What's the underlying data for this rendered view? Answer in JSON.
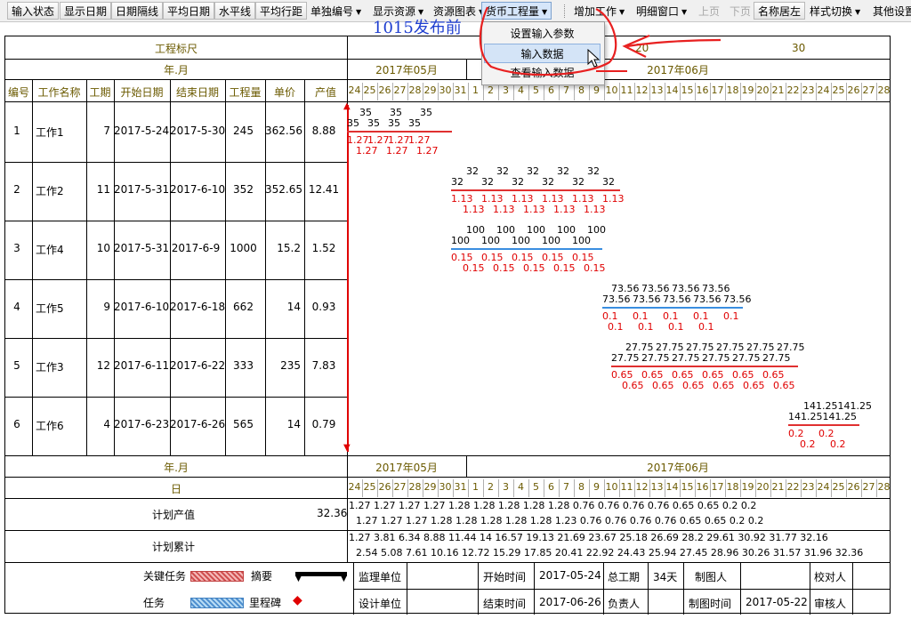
{
  "toolbar": {
    "items": [
      "输入状态",
      "显示日期",
      "日期隔线",
      "平均日期",
      "水平线",
      "平均行距",
      "单独编号",
      "显示资源",
      "资源图表",
      "货币工程量",
      "增加工作",
      "明细窗口",
      "上页",
      "下页",
      "名称居左",
      "样式切换",
      "其他设置"
    ]
  },
  "title": "1015发布前",
  "menu": {
    "items": [
      "设置输入参数",
      "输入数据",
      "查看输入数据"
    ]
  },
  "ruler": {
    "label": "工程标尺",
    "ticks": [
      "20",
      "30"
    ],
    "yearmonth_label": "年.月",
    "day_label": "日",
    "months": [
      "2017年05月",
      "2017年06月"
    ],
    "days": [
      "24",
      "25",
      "26",
      "27",
      "28",
      "29",
      "30",
      "31",
      "1",
      "2",
      "3",
      "4",
      "5",
      "6",
      "7",
      "8",
      "9",
      "10",
      "11",
      "12",
      "13",
      "14",
      "15",
      "16",
      "17",
      "18",
      "19",
      "20",
      "21",
      "22",
      "23",
      "24",
      "25",
      "26",
      "27",
      "28"
    ]
  },
  "table": {
    "headers": [
      "编号",
      "工作名称",
      "工期",
      "开始日期",
      "结束日期",
      "工程量",
      "单价",
      "产值"
    ],
    "rows": [
      [
        "1",
        "工作1",
        "7",
        "2017-5-24",
        "2017-5-30",
        "245",
        "362.56",
        "8.88"
      ],
      [
        "2",
        "工作2",
        "11",
        "2017-5-31",
        "2017-6-10",
        "352",
        "352.65",
        "12.41"
      ],
      [
        "3",
        "工作4",
        "10",
        "2017-5-31",
        "2017-6-9",
        "1000",
        "15.2",
        "1.52"
      ],
      [
        "4",
        "工作5",
        "9",
        "2017-6-10",
        "2017-6-18",
        "662",
        "14",
        "0.93"
      ],
      [
        "5",
        "工作3",
        "12",
        "2017-6-11",
        "2017-6-22",
        "333",
        "235",
        "7.83"
      ],
      [
        "6",
        "工作6",
        "4",
        "2017-6-23",
        "2017-6-26",
        "565",
        "14",
        "0.79"
      ]
    ]
  },
  "bars": [
    {
      "top": [
        "35",
        "35",
        "35"
      ],
      "mid": [
        "35",
        "35",
        "35",
        "35"
      ],
      "r1": [
        "1.27",
        "1.27",
        "1.27",
        "1.27"
      ],
      "r2": [
        "1.27",
        "1.27",
        "1.27"
      ],
      "color": "#e03030"
    },
    {
      "top": [
        "32",
        "32",
        "32",
        "32",
        "32"
      ],
      "mid": [
        "32",
        "32",
        "32",
        "32",
        "32",
        "32"
      ],
      "r1": [
        "1.13",
        "1.13",
        "1.13",
        "1.13",
        "1.13",
        "1.13"
      ],
      "r2": [
        "1.13",
        "1.13",
        "1.13",
        "1.13",
        "1.13"
      ],
      "color": "#e03030"
    },
    {
      "top": [
        "100",
        "100",
        "100",
        "100",
        "100"
      ],
      "mid": [
        "100",
        "100",
        "100",
        "100",
        "100"
      ],
      "r1": [
        "0.15",
        "0.15",
        "0.15",
        "0.15",
        "0.15"
      ],
      "r2": [
        "0.15",
        "0.15",
        "0.15",
        "0.15",
        "0.15"
      ],
      "color": "#3a8ee0"
    },
    {
      "top": [
        "73.56",
        "73.56",
        "73.56",
        "73.56"
      ],
      "mid": [
        "73.56",
        "73.56",
        "73.56",
        "73.56",
        "73.56"
      ],
      "r1": [
        "0.1",
        "0.1",
        "0.1",
        "0.1",
        "0.1"
      ],
      "r2": [
        "0.1",
        "0.1",
        "0.1",
        "0.1"
      ],
      "color": "#3a8ee0"
    },
    {
      "top": [
        "27.75",
        "27.75",
        "27.75",
        "27.75",
        "27.75",
        "27.75"
      ],
      "mid": [
        "27.75",
        "27.75",
        "27.75",
        "27.75",
        "27.75",
        "27.75"
      ],
      "r1": [
        "0.65",
        "0.65",
        "0.65",
        "0.65",
        "0.65",
        "0.65"
      ],
      "r2": [
        "0.65",
        "0.65",
        "0.65",
        "0.65",
        "0.65",
        "0.65"
      ],
      "color": "#e03030"
    },
    {
      "top": [
        "141.25141.25"
      ],
      "mid": [
        "141.25141.25"
      ],
      "r1": [
        "0.2",
        "0.2"
      ],
      "r2": [
        "0.2",
        "0.2"
      ],
      "color": "#e03030"
    }
  ],
  "footer": {
    "plan_value_label": "计划产值",
    "plan_value_total": "32.36",
    "plan_cum_label": "计划累计",
    "plan_value_row1": "1.27 1.27  1.27  1.27  1.28  1.28  1.28  1.28  1.28  0.76  0.76  0.76  0.76  0.65  0.65  0.2   0.2",
    "plan_value_row2": "1.27  1.27  1.27  1.28  1.28  1.28  1.28  1.28  1.23  0.76  0.76  0.76  0.76  0.65  0.65  0.2   0.2",
    "plan_cum_row1": "1.27 3.81  6.34  8.88 11.44  14   16.57 19.13 21.69 23.67 25.18 26.69  28.2  29.61 30.92 31.77 32.16",
    "plan_cum_row2": "2.54  5.08  7.61 10.16 12.72 15.29 17.85 20.41 22.92 24.43 25.94 27.45 28.96 30.26 31.57 31.96 32.36"
  },
  "legend": {
    "critical": "关键任务",
    "summary": "摘要",
    "task": "任务",
    "milestone": "里程碑",
    "supervisor": "监理单位",
    "designer": "设计单位",
    "start_label": "开始时间",
    "start_value": "2017-05-24",
    "end_label": "结束时间",
    "end_value": "2017-06-26",
    "duration_label": "总工期",
    "duration_value": "34天",
    "owner_label": "负责人",
    "drawer_label": "制图人",
    "draw_time_label": "制图时间",
    "draw_time_value": "2017-05-22",
    "checker_label": "校对人",
    "reviewer_label": "审核人"
  }
}
